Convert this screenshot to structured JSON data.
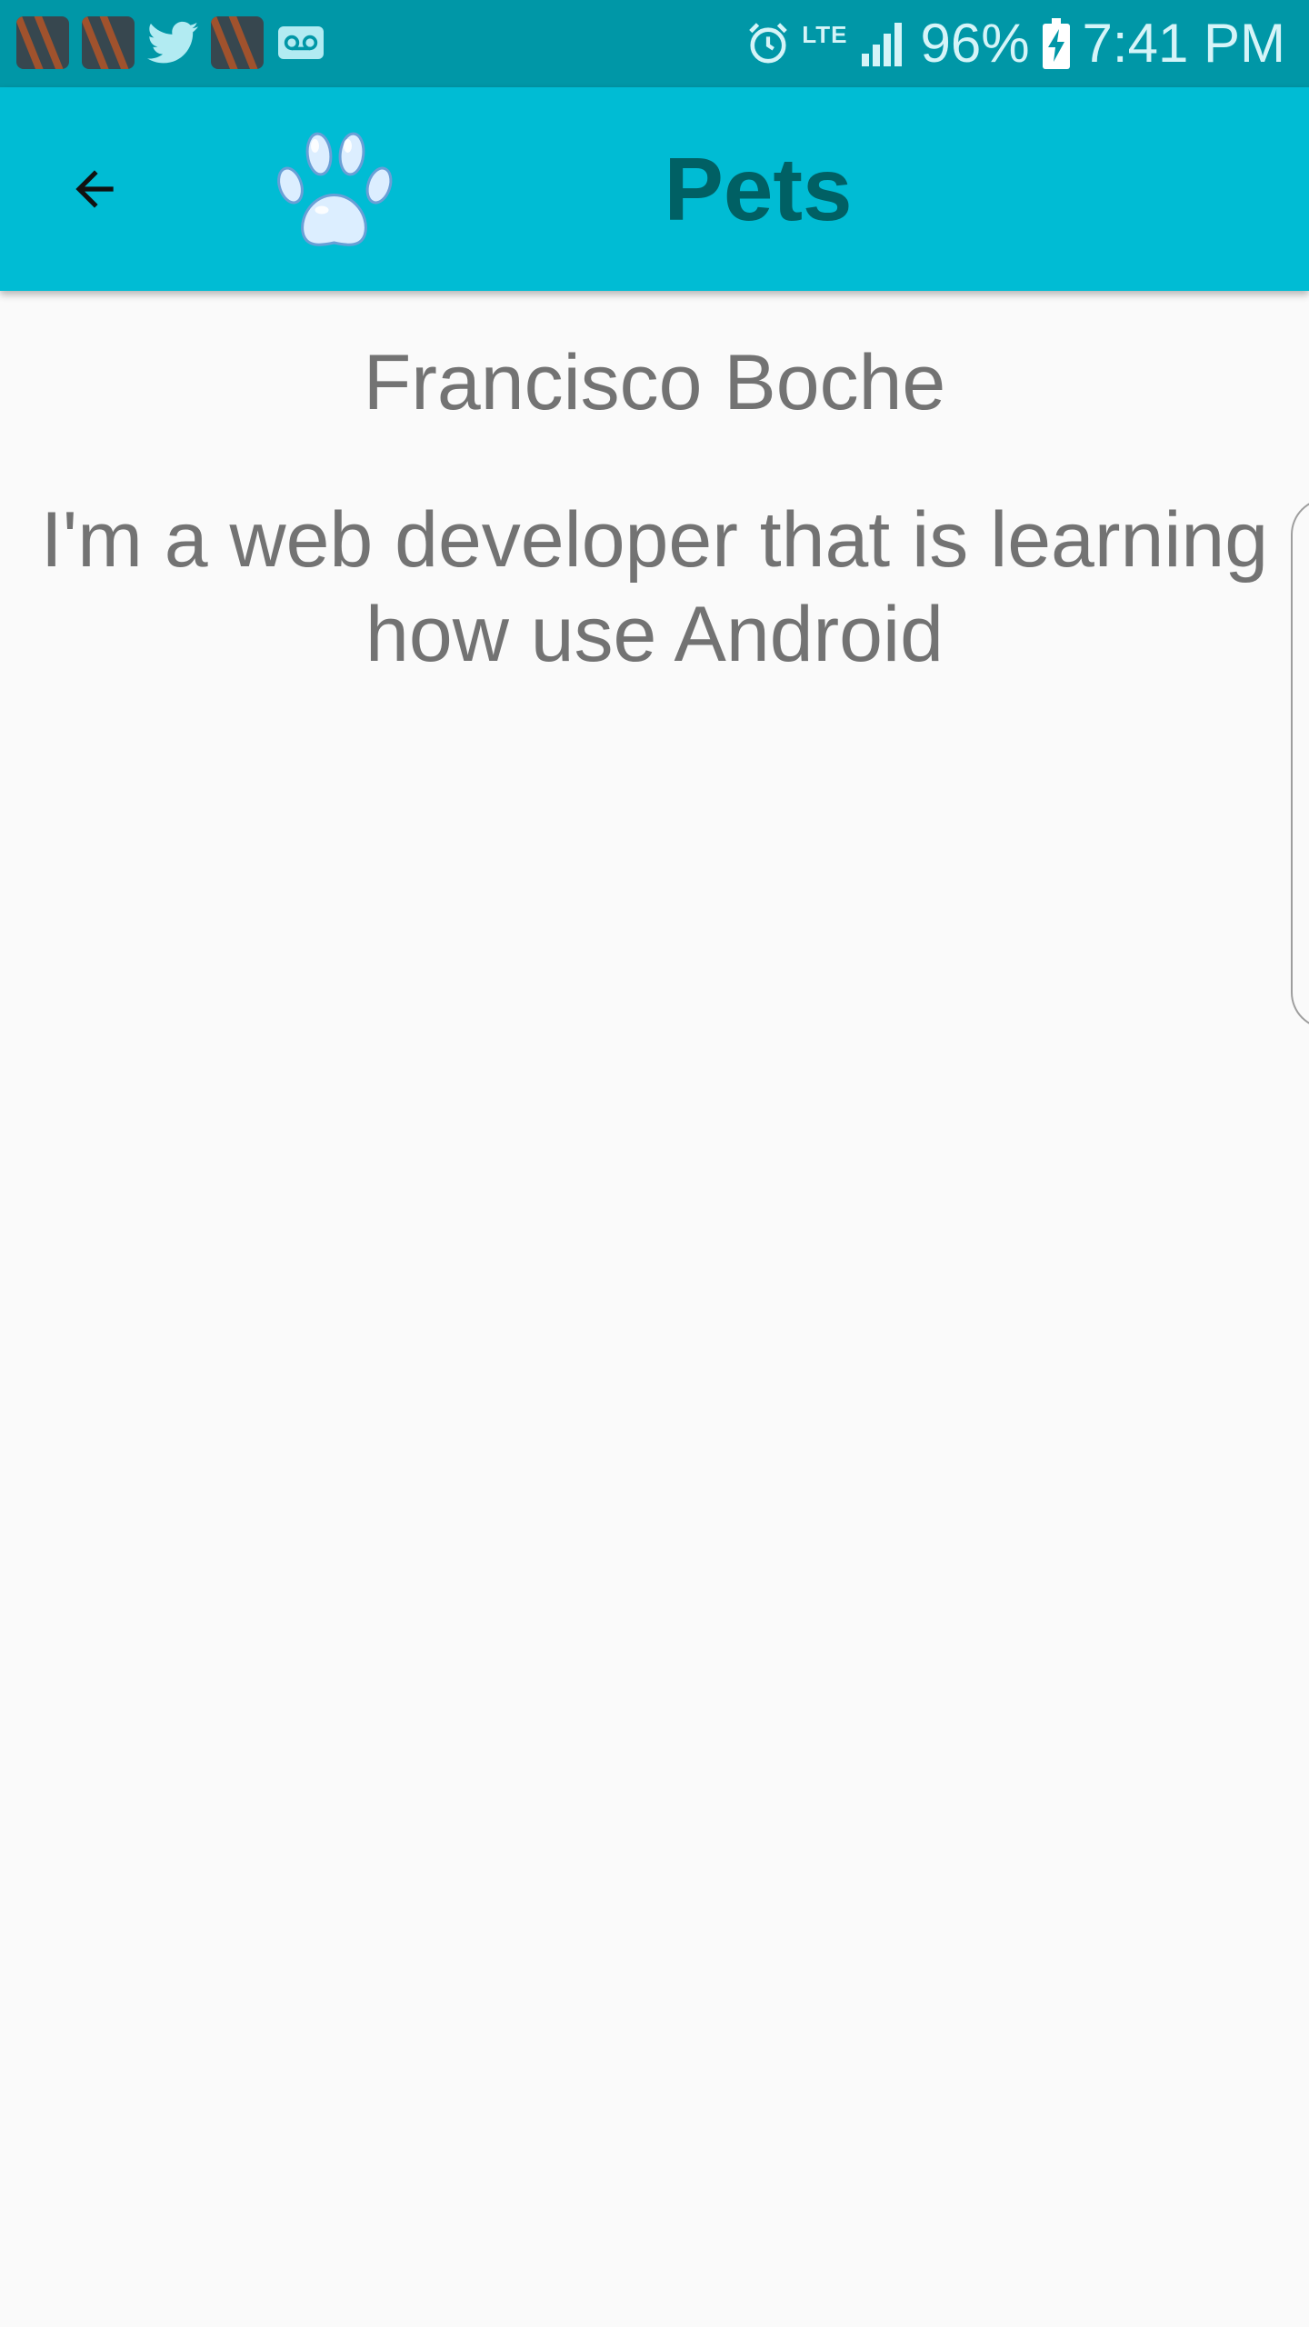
{
  "status_bar": {
    "battery": "96%",
    "time": "7:41 PM",
    "network": "LTE",
    "icons": [
      "app-notification-icon",
      "app-notification-icon",
      "twitter-icon",
      "app-notification-icon",
      "voicemail-icon",
      "alarm-icon",
      "signal-icon",
      "battery-charging-icon"
    ]
  },
  "toolbar": {
    "title": "Pets",
    "back_icon": "arrow-back-icon",
    "logo_icon": "paw-icon"
  },
  "profile": {
    "name": "Francisco Boche",
    "bio": "I'm a web developer that is learning how use Android"
  },
  "colors": {
    "status_bar": "#0097a7",
    "toolbar": "#00bcd4",
    "title_text": "#006064",
    "body_text": "#737373",
    "background": "#fafafa",
    "paw": "#dceeff"
  }
}
